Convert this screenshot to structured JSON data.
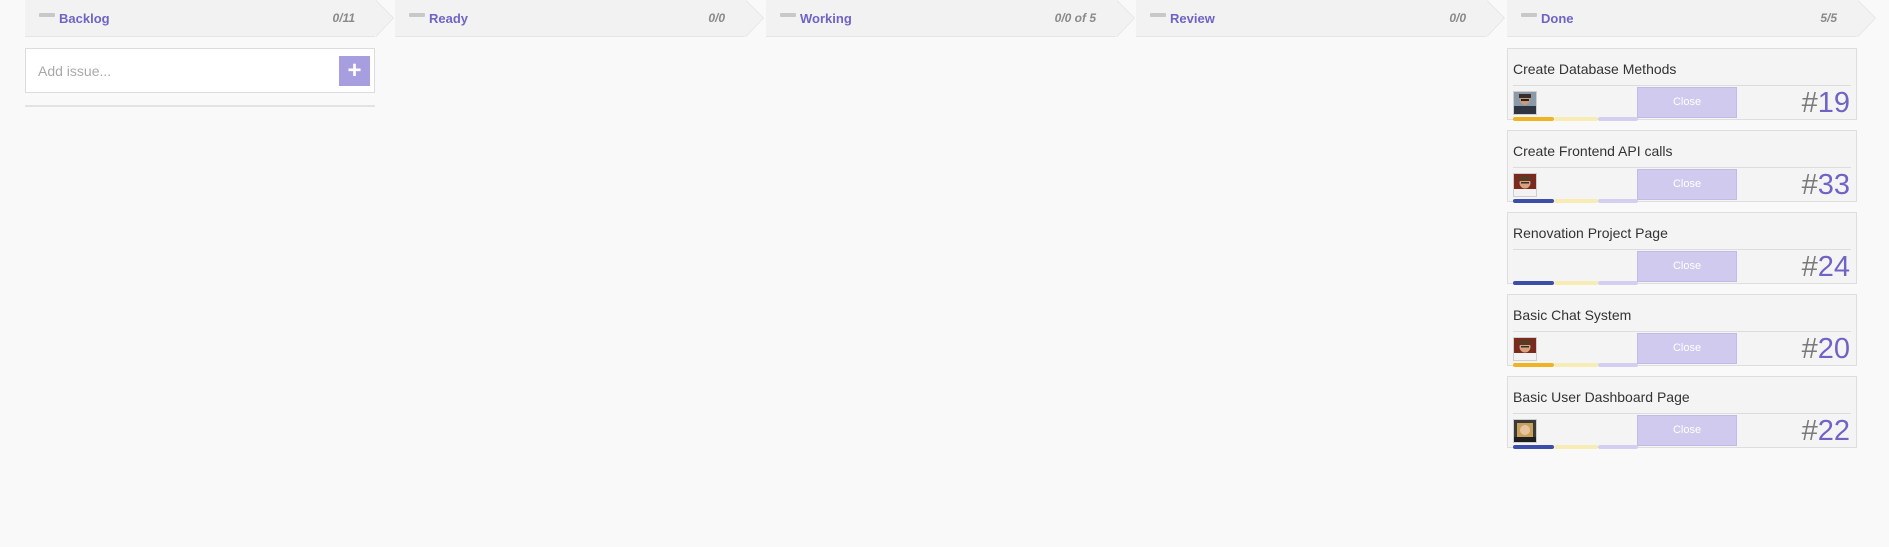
{
  "columns": [
    {
      "title": "Backlog",
      "count": "0/11"
    },
    {
      "title": "Ready",
      "count": "0/0"
    },
    {
      "title": "Working",
      "count": "0/0 of 5"
    },
    {
      "title": "Review",
      "count": "0/0"
    },
    {
      "title": "Done",
      "count": "5/5"
    }
  ],
  "add_issue": {
    "placeholder": "Add issue...",
    "button_label": "+"
  },
  "colors": {
    "accent": "#6f64c6",
    "close_button": "#cfcaee",
    "bar_orange": "#f0b323",
    "bar_blue": "#3b4fa8",
    "bar_yellow": "#f6ecb4",
    "bar_lavender": "#d4cff0"
  },
  "done_cards": [
    {
      "title": "Create Database Methods",
      "close_label": "Close",
      "number": "19",
      "has_avatar": true,
      "avatar": "avatar-man-glasses",
      "bar_color": "orange"
    },
    {
      "title": "Create Frontend API calls",
      "close_label": "Close",
      "number": "33",
      "has_avatar": true,
      "avatar": "avatar-man-red",
      "bar_color": "blue"
    },
    {
      "title": "Renovation Project Page",
      "close_label": "Close",
      "number": "24",
      "has_avatar": false,
      "avatar": "",
      "bar_color": "blue"
    },
    {
      "title": "Basic Chat System",
      "close_label": "Close",
      "number": "20",
      "has_avatar": true,
      "avatar": "avatar-man-red",
      "bar_color": "orange"
    },
    {
      "title": "Basic User Dashboard Page",
      "close_label": "Close",
      "number": "22",
      "has_avatar": true,
      "avatar": "avatar-woman-blonde",
      "bar_color": "blue"
    }
  ]
}
